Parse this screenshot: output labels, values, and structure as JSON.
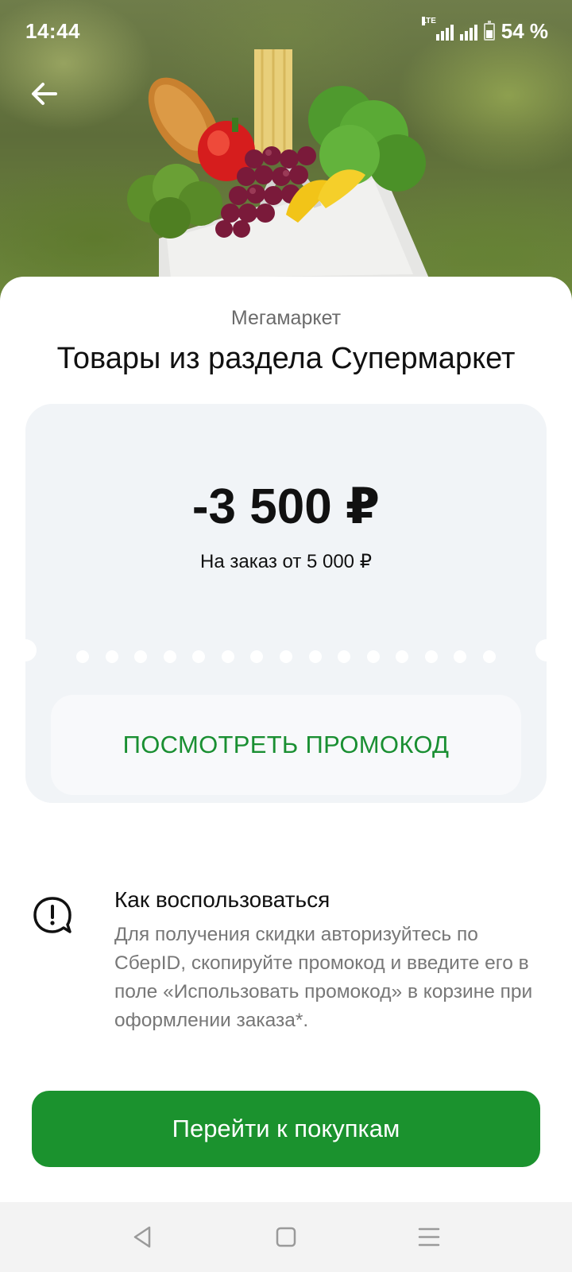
{
  "status": {
    "time": "14:44",
    "network": "LTE",
    "battery_level": 0.54,
    "battery": "54 %"
  },
  "header": {
    "back_icon": "arrow-left-icon"
  },
  "offer": {
    "brand": "Мегамаркет",
    "title": "Товары из раздела Супермаркет",
    "amount": "-3 500 ₽",
    "condition": "На заказ от 5 000 ₽",
    "promo_button": "ПОСМОТРЕТЬ ПРОМОКОД"
  },
  "howto": {
    "icon": "exclamation-bubble-icon",
    "title": "Как воспользоваться",
    "text": "Для получения скидки авторизуйтесь по СберID, скопируйте промокод и введите его в поле «Использовать промокод» в корзине при оформлении заказа*."
  },
  "cta": {
    "label": "Перейти к покупкам"
  },
  "colors": {
    "accent_green": "#1b922e",
    "promo_text_green": "#1a8f32",
    "card_background": "#f1f4f7"
  },
  "navbar": {
    "icons": [
      "back-triangle-icon",
      "home-square-icon",
      "menu-lines-icon"
    ]
  }
}
